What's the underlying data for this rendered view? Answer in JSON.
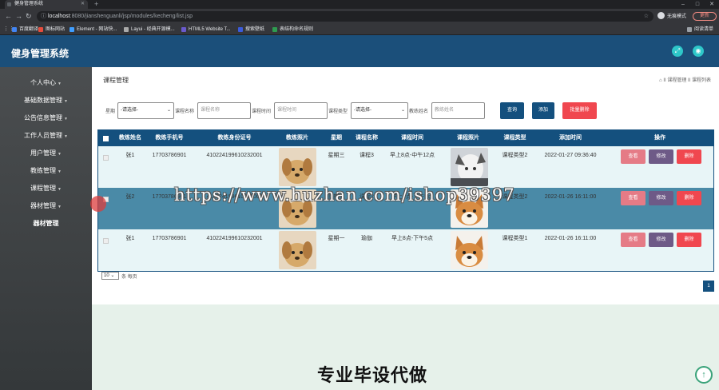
{
  "browser": {
    "tab_title": "健身管理系统",
    "url_host": "localhost",
    "url_path": ":8080/jianshenguanli/jsp/modules/kecheng/list.jsp",
    "profile_label": "无痕模式",
    "update_label": "更新",
    "bookmarks": [
      "百度翻译",
      "图标网站",
      "Element - 网站快...",
      "Layui - 经典开源模...",
      "HTML5 Website T...",
      "搜索壁纸",
      "表结构命名规则"
    ],
    "reading_list": "阅读清单"
  },
  "app": {
    "title": "健身管理系统"
  },
  "sidebar": {
    "items": [
      "个人中心",
      "基础数据管理",
      "公告信息管理",
      "工作人员管理",
      "用户管理",
      "教练管理",
      "课程管理",
      "器材管理",
      "器材管理"
    ]
  },
  "page": {
    "title": "课程管理",
    "breadcrumb": "II 课程管理 II 课程列表"
  },
  "filters": {
    "weekday_label": "星期",
    "weekday_value": "-请选择-",
    "course_name_label": "课程名称",
    "course_name_placeholder": "课程名称",
    "course_time_label": "课程时间",
    "course_time_placeholder": "课程时间",
    "course_type_label": "课程类型",
    "course_type_value": "-请选择-",
    "coach_name_label": "教练姓名",
    "coach_name_placeholder": "教练姓名",
    "search_label": "查询",
    "add_label": "添加",
    "batch_delete_label": "批量删除"
  },
  "table": {
    "headers": [
      "教练姓名",
      "教练手机号",
      "教练身份证号",
      "教练照片",
      "星期",
      "课程名称",
      "课程时间",
      "课程照片",
      "课程类型",
      "添加时间",
      "操作"
    ],
    "rows": [
      {
        "name": "张1",
        "phone": "17703786901",
        "idcard": "410224199610232001",
        "weekday": "星期三",
        "course": "课程3",
        "time": "早上8点-中午12点",
        "type": "课程类型2",
        "added": "2022-01-27 09:36:40"
      },
      {
        "name": "张2",
        "phone": "17703786901",
        "idcard": "410224199610232002",
        "weekday": "星期二",
        "course": "课程2",
        "time": "早上8点-下午5点",
        "type": "课程类型2",
        "added": "2022-01-26 16:11:00"
      },
      {
        "name": "张1",
        "phone": "17703786901",
        "idcard": "410224199610232001",
        "weekday": "星期一",
        "course": "瑜伽",
        "time": "早上8点-下午5点",
        "type": "课程类型1",
        "added": "2022-01-26 16:11:00"
      }
    ],
    "view_label": "查看",
    "edit_label": "修改",
    "delete_label": "删除"
  },
  "pagination": {
    "page_size": "10",
    "per_page_text": "条 每页",
    "current_page": "1"
  },
  "overlay": {
    "watermark": "https://www.huzhan.com/ishop39397",
    "promo": "专业毕设代做"
  },
  "colors": {
    "header": "#1b4f7a",
    "table_header": "#14507e",
    "view_btn": "#e57b86",
    "edit_btn": "#6e5a87",
    "delete_btn": "#f0474f",
    "search_btn": "#14507e",
    "batch_delete_btn": "#f0474f"
  }
}
